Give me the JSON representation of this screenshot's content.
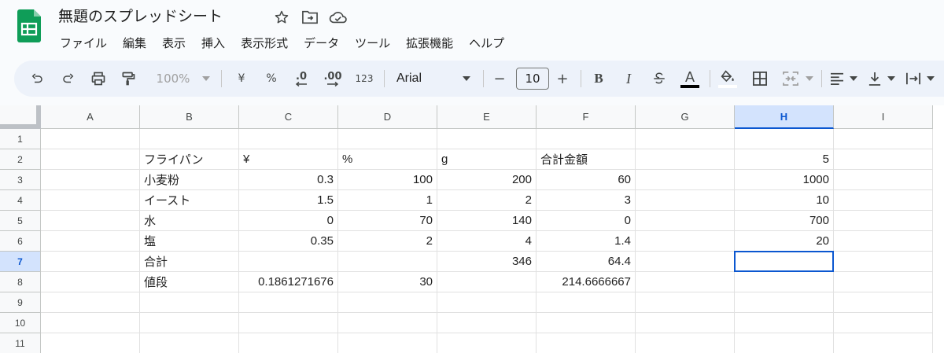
{
  "app": {
    "title": "無題のスプレッドシート",
    "accent": "#0b57d0",
    "logo_color": "#0f9d58",
    "icons": [
      "star-icon",
      "move-to-folder-icon",
      "cloud-status-icon"
    ]
  },
  "menu": [
    "ファイル",
    "編集",
    "表示",
    "挿入",
    "表示形式",
    "データ",
    "ツール",
    "拡張機能",
    "ヘルプ"
  ],
  "toolbar": {
    "zoom": "100%",
    "currency": "¥",
    "percent": "%",
    "decrease_decimal": ".0",
    "increase_decimal": ".00",
    "number_format": "123",
    "font": "Arial",
    "font_size": "10",
    "minus": "−",
    "plus": "+",
    "bold": "B",
    "italic": "I",
    "text_color_glyph": "A"
  },
  "columns": [
    "A",
    "B",
    "C",
    "D",
    "E",
    "F",
    "G",
    "H",
    "I"
  ],
  "rows": [
    "1",
    "2",
    "3",
    "4",
    "5",
    "6",
    "7",
    "8",
    "9",
    "10",
    "11"
  ],
  "cells": {
    "B2": "フライパン",
    "C2": "¥",
    "D2": "%",
    "E2": "g",
    "F2": "合計金額",
    "H2": "5",
    "B3": "小麦粉",
    "C3": "0.3",
    "D3": "100",
    "E3": "200",
    "F3": "60",
    "H3": "1000",
    "B4": "イースト",
    "C4": "1.5",
    "D4": "1",
    "E4": "2",
    "F4": "3",
    "H4": "10",
    "B5": "水",
    "C5": "0",
    "D5": "70",
    "E5": "140",
    "F5": "0",
    "H5": "700",
    "B6": "塩",
    "C6": "0.35",
    "D6": "2",
    "E6": "4",
    "F6": "1.4",
    "H6": "20",
    "B7": "合計",
    "E7": "346",
    "F7": "64.4",
    "B8": "値段",
    "C8": "0.1861271676",
    "D8": "30",
    "F8": "214.6666667"
  },
  "selection": {
    "cell": "H7",
    "column": "H",
    "row": "7"
  }
}
